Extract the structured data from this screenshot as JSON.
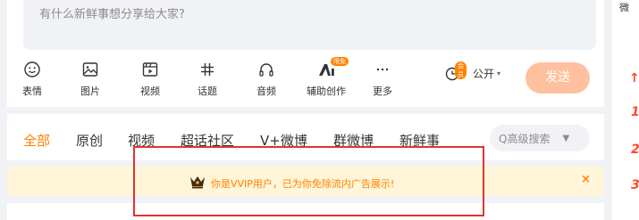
{
  "composer": {
    "placeholder": "有什么新鲜事想分享给大家?",
    "tools": [
      {
        "label": "表情",
        "icon": "emoji-icon"
      },
      {
        "label": "图片",
        "icon": "image-icon"
      },
      {
        "label": "视频",
        "icon": "video-icon"
      },
      {
        "label": "话题",
        "icon": "hashtag-icon"
      },
      {
        "label": "音频",
        "icon": "headphones-icon"
      },
      {
        "label": "辅助创作",
        "icon": "ai-icon",
        "badge": "限免"
      },
      {
        "label": "更多",
        "icon": "more-icon"
      }
    ],
    "schedule_badge": "会员",
    "visibility": "公开",
    "send_label": "发送"
  },
  "tabs": {
    "items": [
      "全部",
      "原创",
      "视频",
      "超话社区",
      "V+微博",
      "群微博",
      "新鲜事"
    ],
    "active": "全部",
    "search_label": "Q高级搜索"
  },
  "notice": {
    "message": "你是VVIP用户，已为你免除流内广告展示!",
    "close": "×"
  },
  "right_panel": {
    "top_char": "微",
    "ranks": [
      "1",
      "2",
      "3"
    ]
  },
  "colors": {
    "accent": "#ff8200",
    "send_disabled": "#ffc09f",
    "notice_bg": "#fff5d9",
    "highlight": "#e5322d"
  }
}
